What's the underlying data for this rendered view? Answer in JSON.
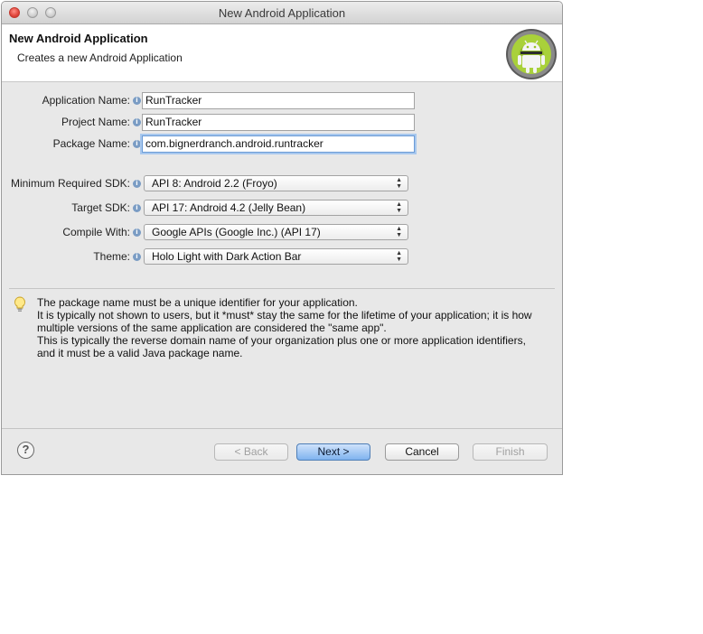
{
  "window": {
    "title": "New Android Application"
  },
  "header": {
    "title": "New Android Application",
    "subtitle": "Creates a new Android Application",
    "logo": "android-logo"
  },
  "form": {
    "app_name": {
      "label": "Application Name:",
      "value": "RunTracker"
    },
    "project_name": {
      "label": "Project Name:",
      "value": "RunTracker"
    },
    "package_name": {
      "label": "Package Name:",
      "value": "com.bignerdranch.android.runtracker"
    },
    "min_sdk": {
      "label": "Minimum Required SDK:",
      "value": "API 8: Android 2.2 (Froyo)"
    },
    "target_sdk": {
      "label": "Target SDK:",
      "value": "API 17: Android 4.2 (Jelly Bean)"
    },
    "compile_with": {
      "label": "Compile With:",
      "value": "Google APIs (Google Inc.) (API 17)"
    },
    "theme": {
      "label": "Theme:",
      "value": "Holo Light with Dark Action Bar"
    },
    "info_glyph": "i"
  },
  "help": {
    "icon": "lightbulb-icon",
    "lines": [
      "The package name must be a unique identifier for your application.",
      "It is typically not shown to users, but it *must* stay the same for the lifetime of your application; it is how",
      "multiple versions of the same application are considered the \"same app\".",
      "This is typically the reverse domain name of your organization plus one or more application identifiers,",
      "and it must be a valid Java package name."
    ]
  },
  "buttons": {
    "help": "?",
    "back": "< Back",
    "next": "Next >",
    "cancel": "Cancel",
    "finish": "Finish"
  },
  "colors": {
    "accent": "#7fb3ef",
    "focus": "#6b9bd6",
    "android_green": "#97c024"
  }
}
